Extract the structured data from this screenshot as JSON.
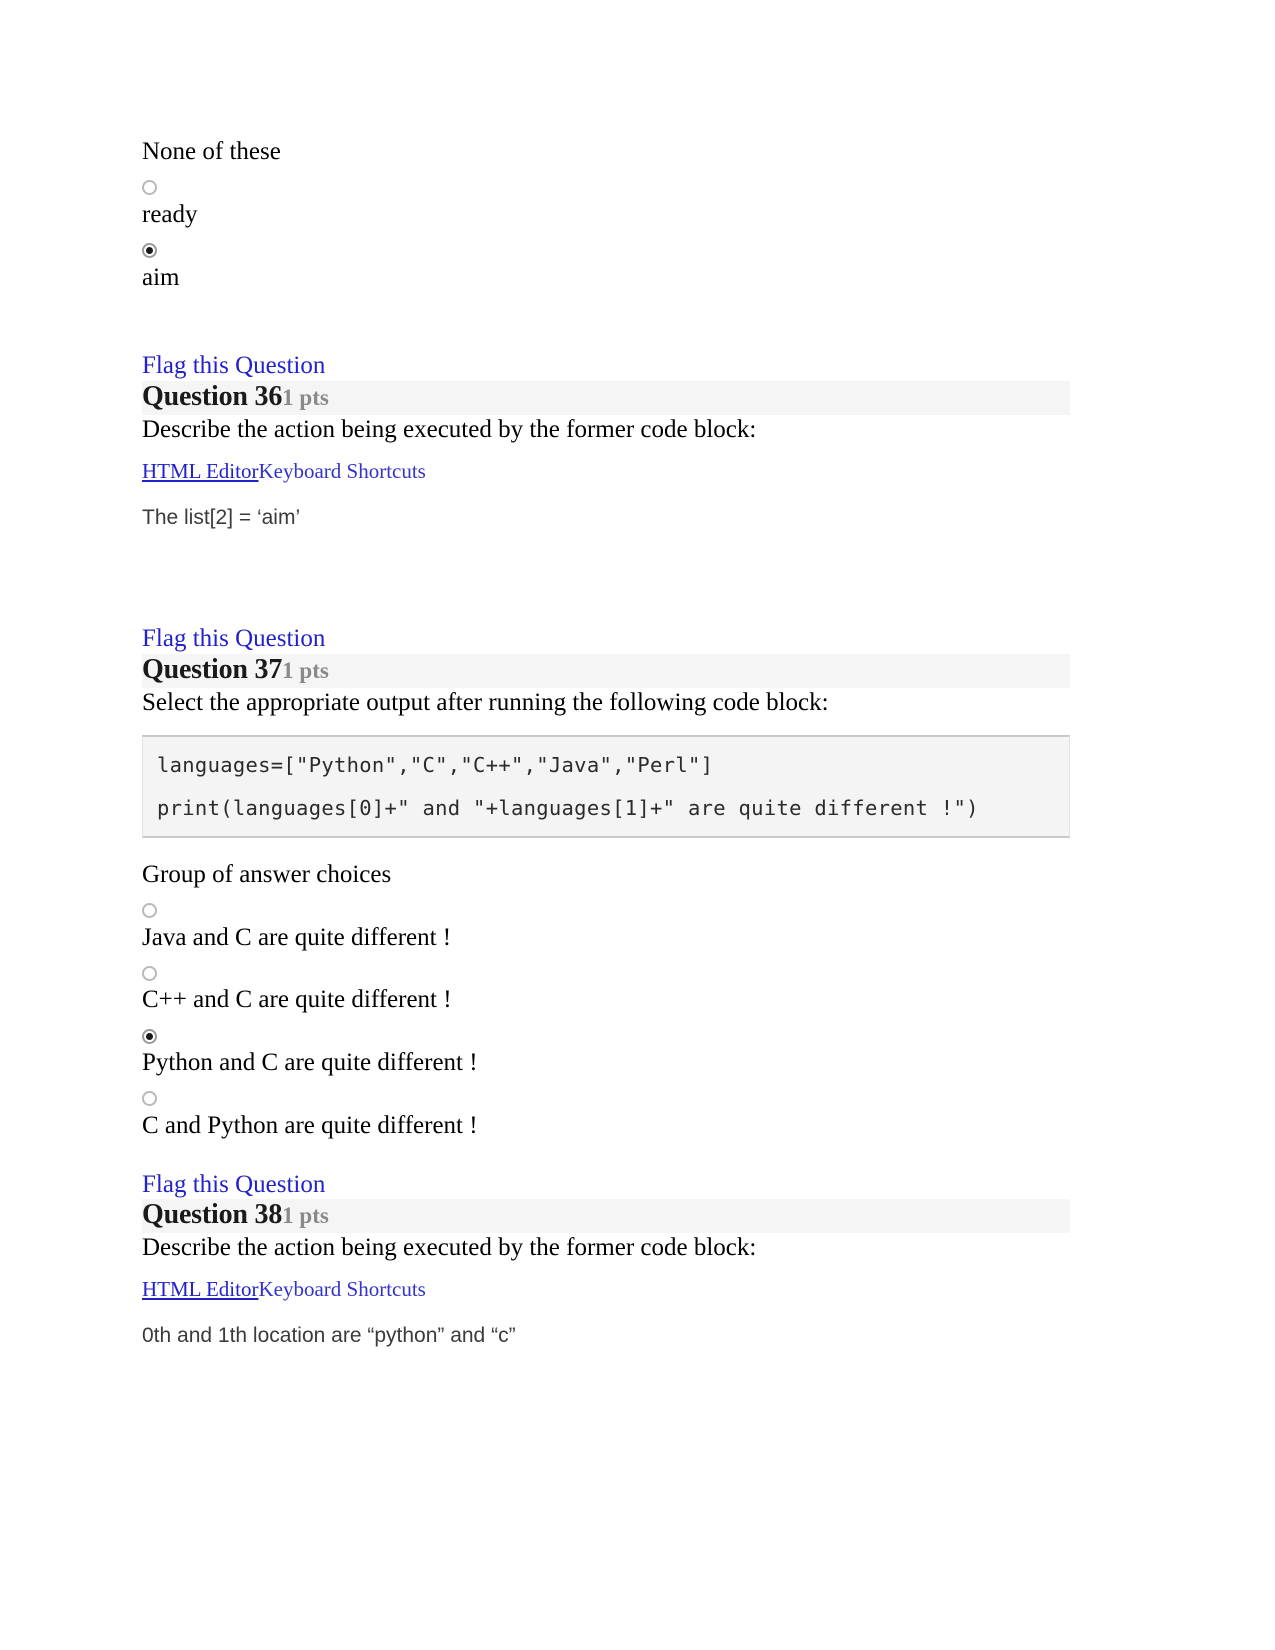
{
  "previous_question_tail": {
    "choices": [
      {
        "label": "None of these",
        "selected": false,
        "radio_before": false
      },
      {
        "label": "ready",
        "selected": false,
        "radio_before": true
      },
      {
        "label": "aim",
        "selected": true,
        "radio_before": true
      }
    ]
  },
  "labels": {
    "flag_this_question": "Flag this Question",
    "group_of_answer_choices": "Group of answer choices",
    "html_editor": "HTML Editor",
    "keyboard_shortcuts": "Keyboard Shortcuts"
  },
  "questions": [
    {
      "number_label": "Question 36",
      "points_label": "1 pts",
      "prompt": "Describe the action being executed by the former code block:",
      "type": "essay",
      "answer_text": "The list[2] = ‘aim’"
    },
    {
      "number_label": "Question 37",
      "points_label": "1 pts",
      "prompt": "Select the appropriate output after running the following code block:",
      "type": "multiple-choice",
      "code_lines": [
        "languages=[\"Python\",\"C\",\"C++\",\"Java\",\"Perl\"]",
        "print(languages[0]+\" and \"+languages[1]+\" are quite different !\")"
      ],
      "choices": [
        {
          "label": "Java and C are quite different !",
          "selected": false
        },
        {
          "label": "C++ and C are quite different !",
          "selected": false
        },
        {
          "label": "Python and C are quite different !",
          "selected": true
        },
        {
          "label": "C and Python are quite different !",
          "selected": false
        }
      ]
    },
    {
      "number_label": "Question 38",
      "points_label": "1 pts",
      "prompt": "Describe the action being executed by the former code block:",
      "type": "essay",
      "answer_text": "0th and 1th location are “python” and “c”"
    }
  ],
  "colors": {
    "link": "#2222cc",
    "header_band": "#f5f5f5",
    "points_gray": "#8a8a8a",
    "code_background": "#f4f4f4",
    "code_border": "#c9c9c9"
  }
}
